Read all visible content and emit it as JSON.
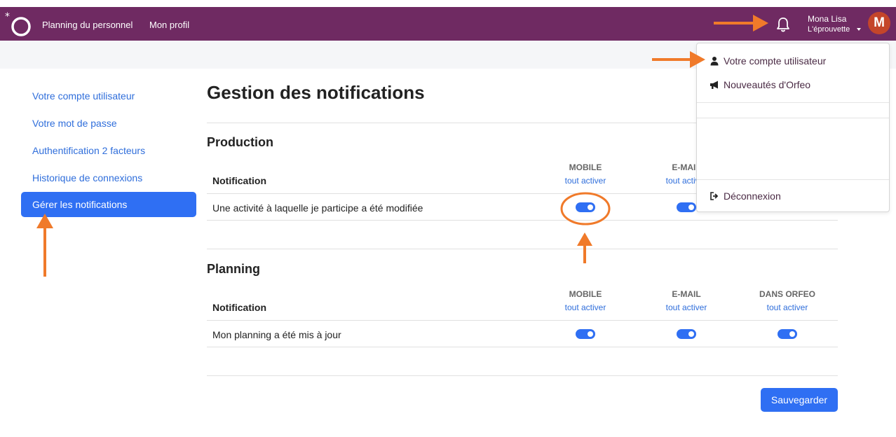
{
  "topbar": {
    "nav": [
      "Planning du personnel",
      "Mon profil"
    ],
    "user_name": "Mona Lisa",
    "user_org": "L'éprouvette",
    "avatar_initial": "M",
    "brand_color": "#6f2a62",
    "avatar_color": "#c4452a"
  },
  "sidebar": {
    "items": [
      {
        "label": "Votre compte utilisateur",
        "active": false
      },
      {
        "label": "Votre mot de passe",
        "active": false
      },
      {
        "label": "Authentification 2 facteurs",
        "active": false
      },
      {
        "label": "Historique de connexions",
        "active": false
      },
      {
        "label": "Gérer les notifications",
        "active": true
      }
    ]
  },
  "main": {
    "title": "Gestion des notifications",
    "save_label": "Sauvegarder",
    "accent_color": "#2f6ff3",
    "sections": [
      {
        "title": "Production",
        "header_label": "Notification",
        "columns": [
          {
            "name": "MOBILE",
            "link": "tout activer"
          },
          {
            "name": "E-MAIL",
            "link": "tout activer"
          }
        ],
        "rows": [
          {
            "label": "Une activité à laquelle je participe a été modifiée",
            "toggles": [
              true,
              true
            ]
          }
        ]
      },
      {
        "title": "Planning",
        "header_label": "Notification",
        "columns": [
          {
            "name": "MOBILE",
            "link": "tout activer"
          },
          {
            "name": "E-MAIL",
            "link": "tout activer"
          },
          {
            "name": "DANS ORFEO",
            "link": "tout activer"
          }
        ],
        "rows": [
          {
            "label": "Mon planning a été mis à jour",
            "toggles": [
              true,
              true,
              true
            ]
          }
        ]
      }
    ]
  },
  "dropdown": {
    "items": [
      {
        "label": "Votre compte utilisateur",
        "icon": "user-icon"
      },
      {
        "label": "Nouveautés d'Orfeo",
        "icon": "megaphone-icon"
      },
      {
        "label": "Déconnexion",
        "icon": "sign-out-icon"
      }
    ]
  },
  "annotations": {
    "arrow_color": "#f07a2a"
  }
}
